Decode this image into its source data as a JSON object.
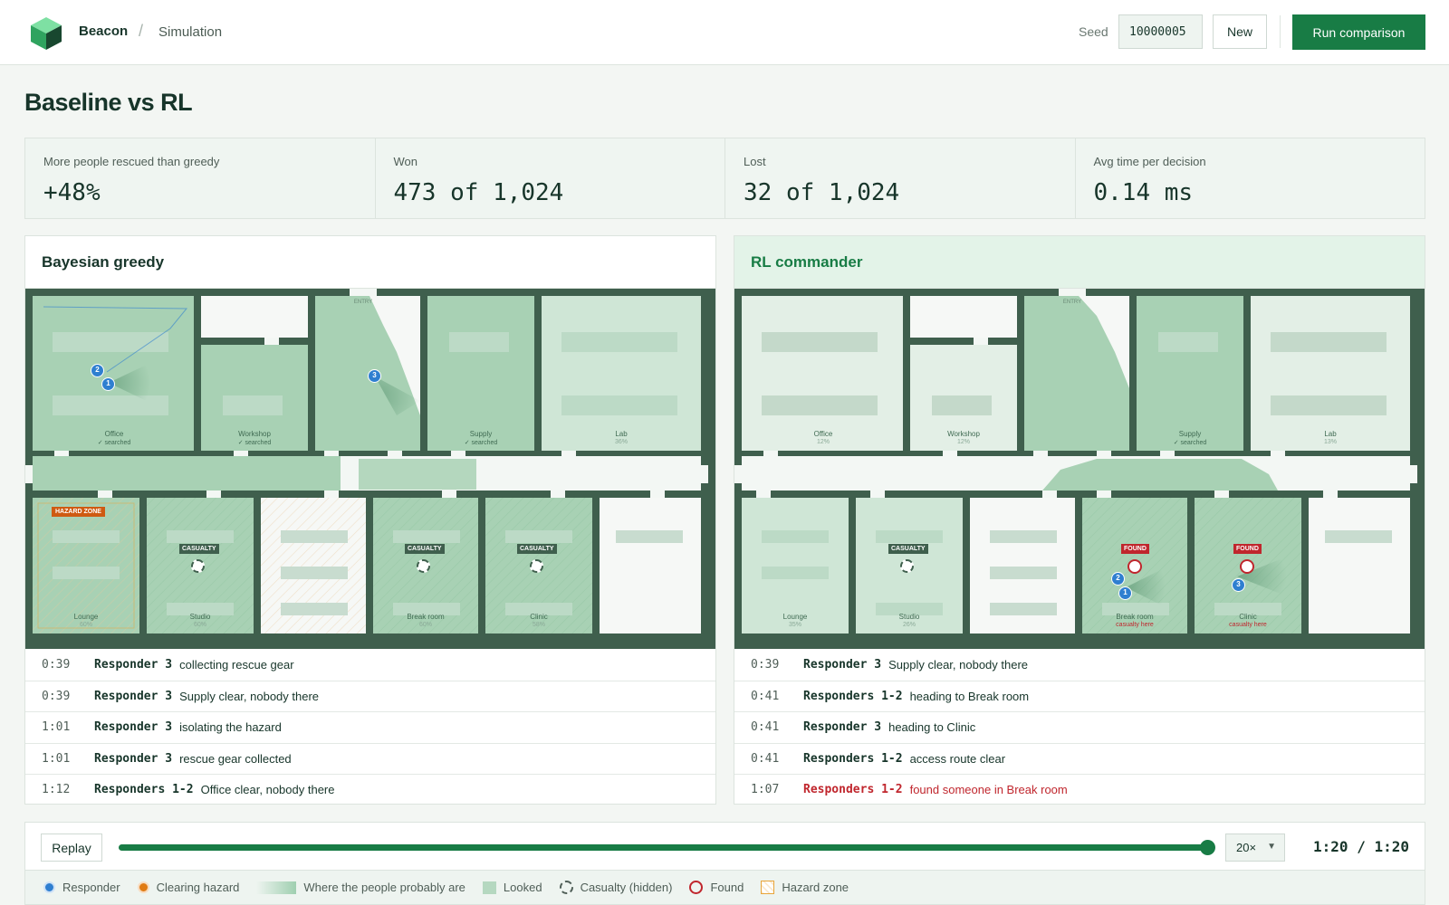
{
  "app": {
    "brand": "Beacon",
    "breadcrumb": "Simulation"
  },
  "toolbar": {
    "seed_label": "Seed",
    "seed_value": "10000005",
    "new_label": "New",
    "run_label": "Run comparison"
  },
  "page_title": "Baseline vs RL",
  "stats": [
    {
      "label": "More people rescued than greedy",
      "value": "+48%"
    },
    {
      "label": "Won",
      "value": "473 of 1,024"
    },
    {
      "label": "Lost",
      "value": "32 of 1,024"
    },
    {
      "label": "Avg time per decision",
      "value": "0.14 ms"
    }
  ],
  "panels": {
    "left": {
      "title": "Bayesian greedy",
      "map_text": {
        "entry": "ENTRY",
        "hazard": "HAZARD ZONE",
        "casualty": "CASUALTY",
        "rooms": [
          {
            "name": "Office",
            "status": "✓ searched"
          },
          {
            "name": "Workshop",
            "status": "✓ searched"
          },
          {
            "name": "Supply",
            "status": "✓ searched"
          },
          {
            "name": "Lab",
            "status": "36%"
          },
          {
            "name": "Lounge",
            "status": "60%"
          },
          {
            "name": "Studio",
            "status": "60%"
          },
          {
            "name": "Break room",
            "status": "60%"
          },
          {
            "name": "Clinic",
            "status": "58%"
          }
        ],
        "responders": [
          "1",
          "2",
          "3"
        ]
      },
      "log": [
        {
          "time": "0:39",
          "who": "Responder 3",
          "msg": "collecting rescue gear",
          "alert": false
        },
        {
          "time": "0:39",
          "who": "Responder 3",
          "msg": "Supply clear, nobody there",
          "alert": false
        },
        {
          "time": "1:01",
          "who": "Responder 3",
          "msg": "isolating the hazard",
          "alert": false
        },
        {
          "time": "1:01",
          "who": "Responder 3",
          "msg": "rescue gear collected",
          "alert": false
        },
        {
          "time": "1:12",
          "who": "Responders 1-2",
          "msg": "Office clear, nobody there",
          "alert": false
        }
      ]
    },
    "right": {
      "title": "RL commander",
      "map_text": {
        "entry": "ENTRY",
        "casualty": "CASUALTY",
        "found": "FOUND",
        "casualty_here": "casualty here",
        "rooms": [
          {
            "name": "Office",
            "status": "12%"
          },
          {
            "name": "Workshop",
            "status": "12%"
          },
          {
            "name": "Supply",
            "status": "✓ searched"
          },
          {
            "name": "Lab",
            "status": "13%"
          },
          {
            "name": "Lounge",
            "status": "35%"
          },
          {
            "name": "Studio",
            "status": "26%"
          },
          {
            "name": "Break room",
            "status": "casualty here"
          },
          {
            "name": "Clinic",
            "status": "casualty here"
          }
        ],
        "responders": [
          "1",
          "2",
          "3"
        ]
      },
      "log": [
        {
          "time": "0:39",
          "who": "Responder 3",
          "msg": "Supply clear, nobody there",
          "alert": false
        },
        {
          "time": "0:41",
          "who": "Responders 1-2",
          "msg": "heading to Break room",
          "alert": false
        },
        {
          "time": "0:41",
          "who": "Responder 3",
          "msg": "heading to Clinic",
          "alert": false
        },
        {
          "time": "0:41",
          "who": "Responders 1-2",
          "msg": "access route clear",
          "alert": false
        },
        {
          "time": "1:07",
          "who": "Responders 1-2",
          "msg": "found someone in Break room",
          "alert": true
        }
      ]
    }
  },
  "playback": {
    "replay_label": "Replay",
    "progress": 1.0,
    "speed": "20×",
    "time": "1:20 / 1:20"
  },
  "legend": [
    {
      "label": "Responder",
      "icon": "responder-dot",
      "color": "#2f7fd0"
    },
    {
      "label": "Clearing hazard",
      "icon": "clearing-hazard-dot",
      "color": "#e07b13"
    },
    {
      "label": "Where the people probably are",
      "icon": "probability-gradient",
      "color": "#9fcfb0"
    },
    {
      "label": "Looked",
      "icon": "looked-swatch",
      "color": "#b5d8c0"
    },
    {
      "label": "Casualty (hidden)",
      "icon": "hidden-casualty-ring",
      "color": "#4f5e57"
    },
    {
      "label": "Found",
      "icon": "found-ring",
      "color": "#c0262d"
    },
    {
      "label": "Hazard zone",
      "icon": "hazard-zone-swatch",
      "color": "#e8a53a"
    }
  ],
  "colors": {
    "accent": "#187c45",
    "alert": "#c0262d",
    "wall": "#3f5f4d"
  }
}
